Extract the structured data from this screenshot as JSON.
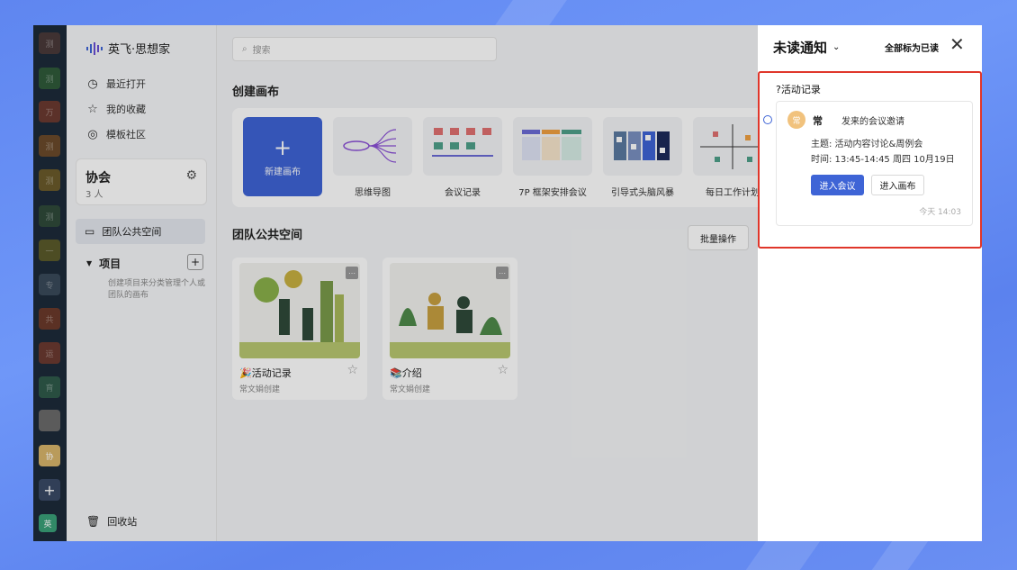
{
  "sidebar": {
    "brand": "英飞·思想家",
    "nav": [
      {
        "label": "最近打开",
        "icon": "clock-icon"
      },
      {
        "label": "我的收藏",
        "icon": "star-icon"
      },
      {
        "label": "模板社区",
        "icon": "planet-icon"
      }
    ],
    "org": {
      "name": "协会",
      "count": "3 人"
    },
    "team_space": "团队公共空间",
    "projects": {
      "label": "项目",
      "hint": "创建项目来分类管理个人或团队的画布"
    },
    "trash": "回收站"
  },
  "workspaces": [
    "测",
    "测",
    "万",
    "测",
    "测",
    "测",
    "一",
    "专",
    "共",
    "运",
    "育",
    "协",
    "英"
  ],
  "main": {
    "search_placeholder": "搜索",
    "create_title": "创建画布",
    "new_canvas": "新建画布",
    "templates": [
      "思维导图",
      "会议记录",
      "7P 框架安排会议",
      "引导式头脑风暴",
      "每日工作计划"
    ],
    "team_title": "团队公共空间",
    "batch": "批量操作",
    "cards": [
      {
        "title": "🎉活动记录",
        "by": "常文娟创建"
      },
      {
        "title": "📚介绍",
        "by": "常文娟创建"
      }
    ]
  },
  "panel": {
    "title": "未读通知",
    "mark_all": "全部标为已读",
    "group": "?活动记录",
    "notification": {
      "avatar": "常",
      "sender": "常",
      "action": "发来的会议邀请",
      "subject": "主题: 活动内容讨论&周例会",
      "time": "时间: 13:45-14:45 周四 10月19日",
      "join": "进入会议",
      "open": "进入画布",
      "timestamp": "今天 14:03"
    }
  },
  "colors": {
    "accent": "#3e64d6",
    "highlight": "#e0362a"
  }
}
